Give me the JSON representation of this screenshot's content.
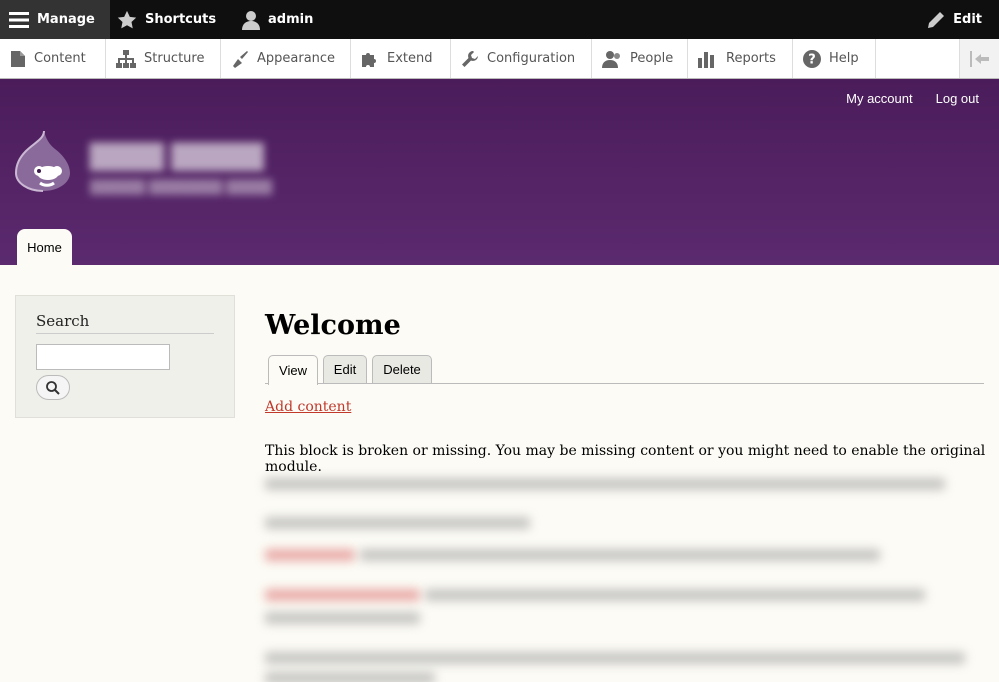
{
  "toolbar": {
    "manage_label": "Manage",
    "shortcuts_label": "Shortcuts",
    "user_label": "admin",
    "edit_label": "Edit"
  },
  "tray": {
    "items": [
      {
        "label": "Content",
        "icon": "file-icon"
      },
      {
        "label": "Structure",
        "icon": "sitemap-icon"
      },
      {
        "label": "Appearance",
        "icon": "paintbrush-icon"
      },
      {
        "label": "Extend",
        "icon": "puzzle-icon"
      },
      {
        "label": "Configuration",
        "icon": "wrench-icon"
      },
      {
        "label": "People",
        "icon": "people-icon"
      },
      {
        "label": "Reports",
        "icon": "bar-chart-icon"
      },
      {
        "label": "Help",
        "icon": "help-icon"
      }
    ]
  },
  "header": {
    "secondary_menu": [
      "My account",
      "Log out"
    ],
    "home_tab": "Home"
  },
  "sidebar": {
    "search_title": "Search"
  },
  "main": {
    "title": "Welcome",
    "tabs": [
      "View",
      "Edit",
      "Delete"
    ],
    "add_content": "Add content",
    "broken_block_message": "This block is broken or missing. You may be missing content or you might need to enable the original module."
  },
  "colors": {
    "header_purple": "#53236a",
    "link_red": "#c0392b",
    "toolbar_dark": "#0f0f0f"
  }
}
